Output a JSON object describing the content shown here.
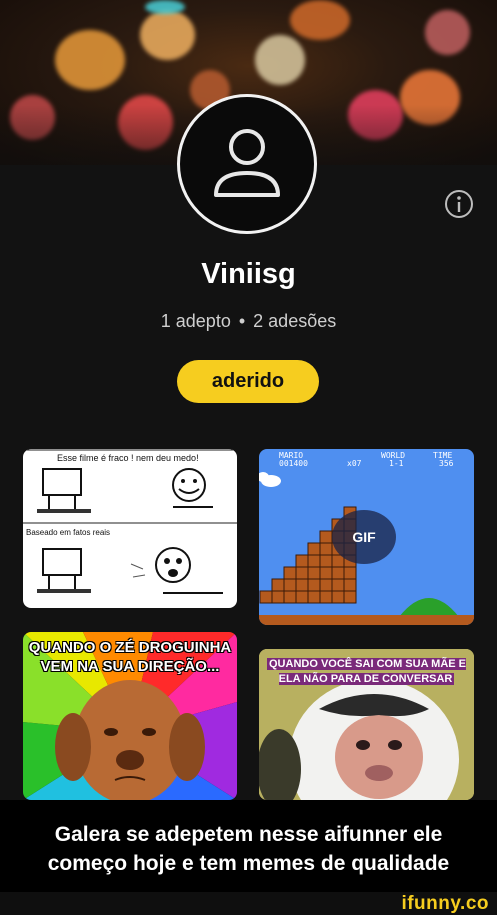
{
  "profile": {
    "username": "Viniisg",
    "followers": "1 adepto",
    "separator": "•",
    "subscriptions": "2 adesões",
    "join_button": "aderido",
    "avatar_icon": "user-icon",
    "info_icon": "info-icon"
  },
  "posts": [
    {
      "kind": "rage-comic",
      "line1": "Esse filme é fraco ! nem deu medo!",
      "line2": "Baseado em fatos reais"
    },
    {
      "kind": "gif",
      "badge": "GIF",
      "hud": [
        "MARIO",
        "001400",
        "x07",
        "WORLD",
        "1-1",
        "TIME",
        "356"
      ]
    },
    {
      "kind": "meme",
      "text_top": "QUANDO O ZÉ DROGUINHA VEM NA SUA DIREÇÃO..."
    },
    {
      "kind": "meme",
      "text_top": "QUANDO VOCÊ SAI COM SUA MÃE E ELA NÃO PARA DE CONVERSAR"
    }
  ],
  "caption": "Galera se adepetem nesse aifunner ele começo hoje e tem memes de qualidade",
  "watermark": "ifunny.co",
  "colors": {
    "accent": "#f6cd1f",
    "background": "#121212"
  }
}
